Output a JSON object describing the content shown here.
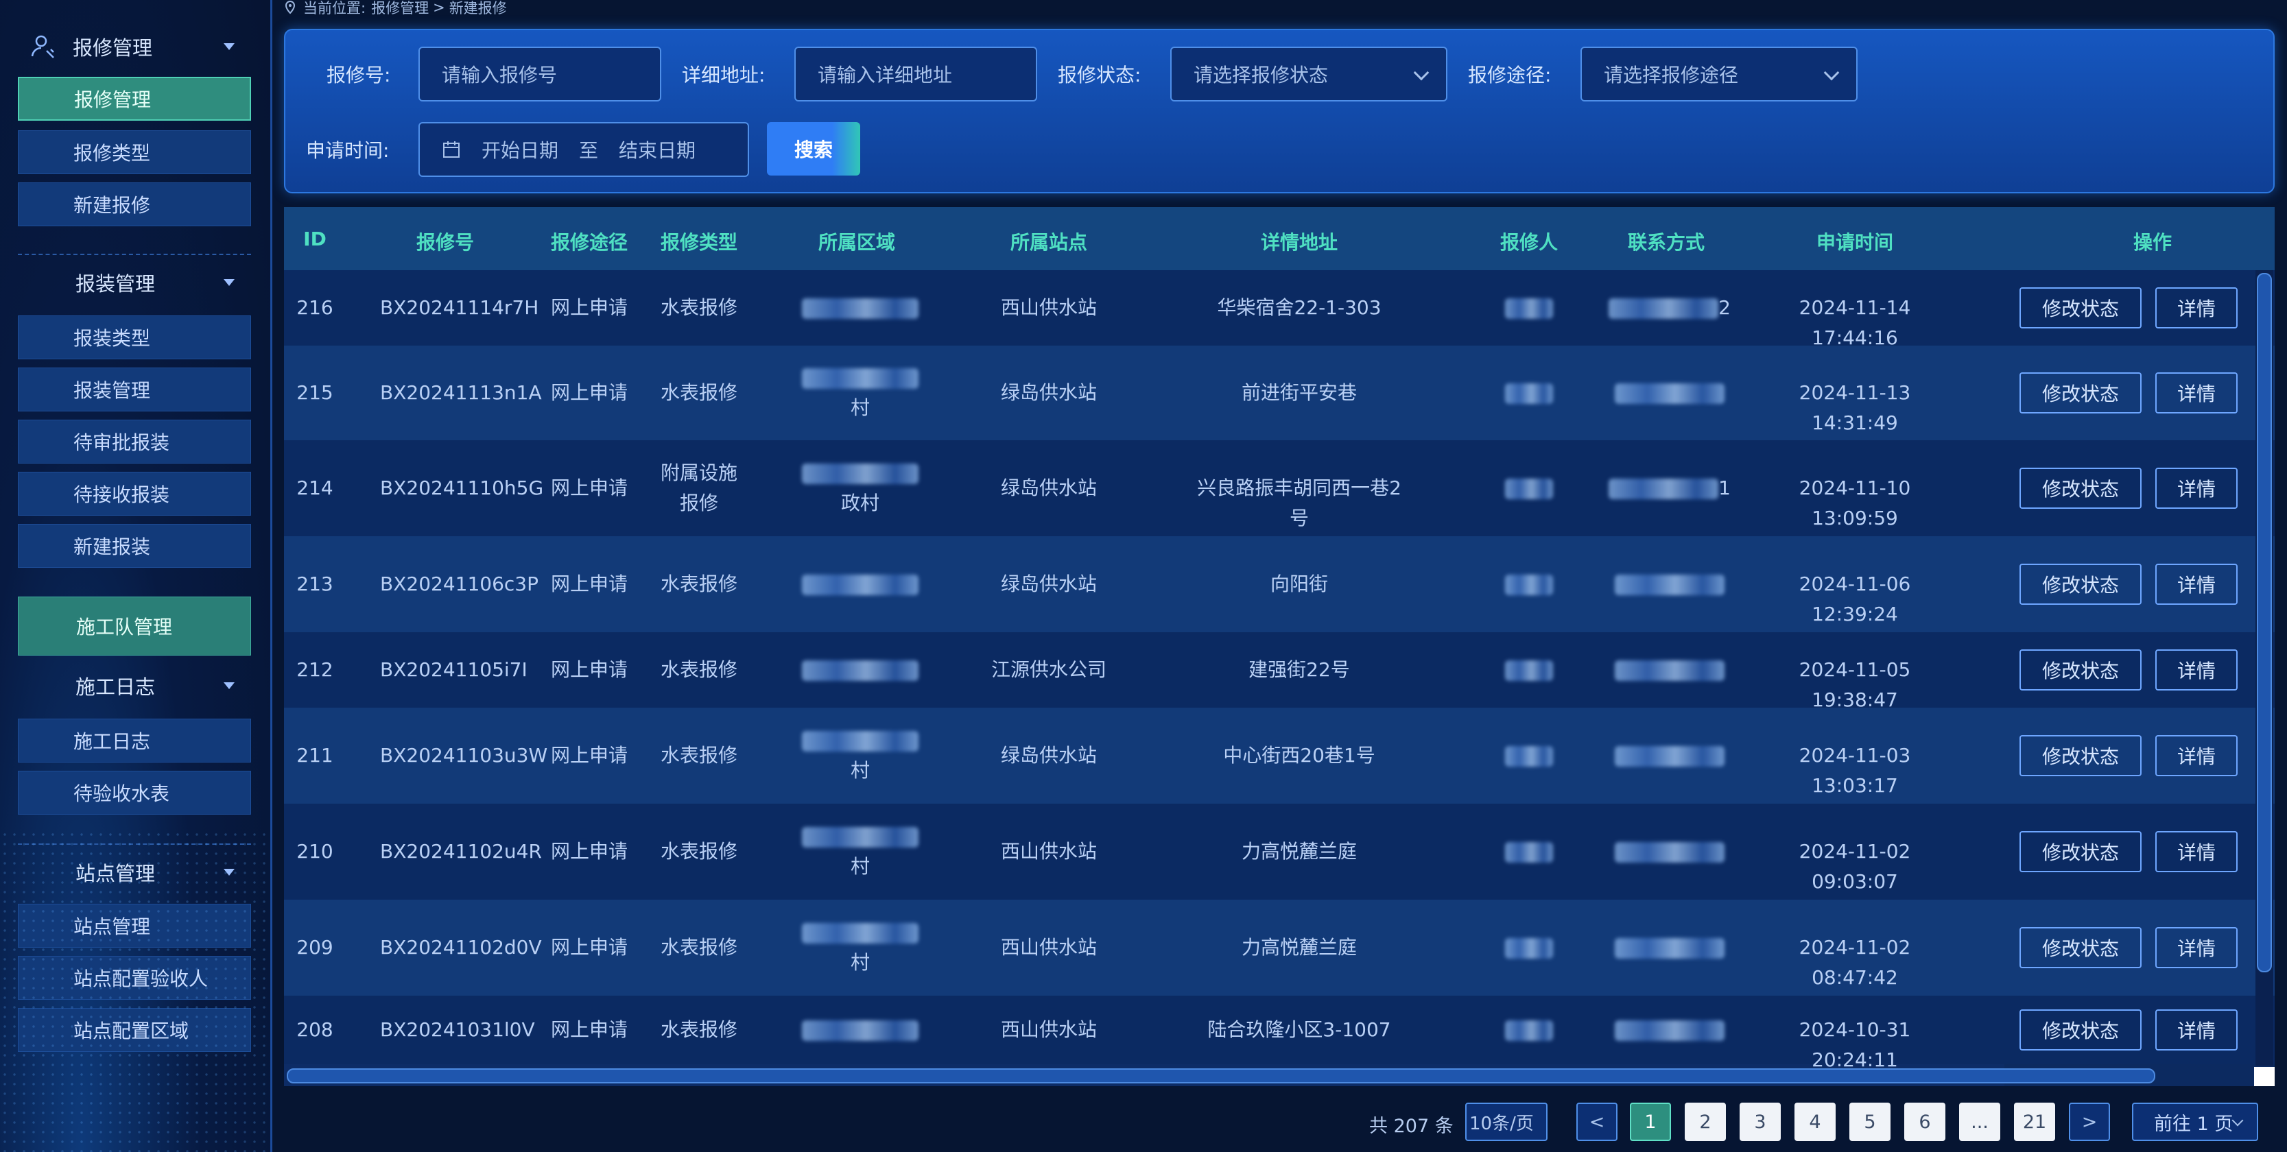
{
  "breadcrumb": {
    "prefix": "当前位置:",
    "path1": "报修管理",
    "sep": ">",
    "path2": "新建报修"
  },
  "sidebar": {
    "group1": "报修管理",
    "group1_items": [
      "报修管理",
      "报修类型",
      "新建报修"
    ],
    "group2": "报装管理",
    "group2_items": [
      "报装类型",
      "报装管理",
      "待审批报装",
      "待接收报装",
      "新建报装"
    ],
    "team": "施工队管理",
    "group3": "施工日志",
    "group3_items": [
      "施工日志",
      "待验收水表"
    ],
    "group4": "站点管理",
    "group4_items": [
      "站点管理",
      "站点配置验收人",
      "站点配置区域"
    ]
  },
  "filter": {
    "repair_no_label": "报修号:",
    "repair_no_placeholder": "请输入报修号",
    "address_label": "详细地址:",
    "address_placeholder": "请输入详细地址",
    "status_label": "报修状态:",
    "status_placeholder": "请选择报修状态",
    "channel_label": "报修途径:",
    "channel_placeholder": "请选择报修途径",
    "date_label": "申请时间:",
    "start_date": "开始日期",
    "to": "至",
    "end_date": "结束日期",
    "search": "搜索"
  },
  "table": {
    "headers": [
      "ID",
      "报修号",
      "报修途径",
      "报修类型",
      "所属区域",
      "所属站点",
      "详情地址",
      "报修人",
      "联系方式",
      "申请时间",
      "操作"
    ],
    "op_edit": "修改状态",
    "op_detail": "详情",
    "rows": [
      {
        "id": "216",
        "no": "BX20241114r7H",
        "channel": "网上申请",
        "type": "水表报修",
        "type2": "",
        "area2": "",
        "station": "西山供水站",
        "addr": "华柴宿舍22-1-303",
        "phone_tail": "2",
        "time": "2024-11-14 17:44:16"
      },
      {
        "id": "215",
        "no": "BX20241113n1A",
        "channel": "网上申请",
        "type": "水表报修",
        "type2": "",
        "area2": "村",
        "station": "绿岛供水站",
        "addr": "前进街平安巷",
        "phone_tail": "",
        "time": "2024-11-13 14:31:49"
      },
      {
        "id": "214",
        "no": "BX20241110h5G",
        "channel": "网上申请",
        "type": "附属设施",
        "type2": "报修",
        "area2": "政村",
        "station": "绿岛供水站",
        "addr": "兴良路振丰胡同西一巷2号",
        "phone_tail": "1",
        "time": "2024-11-10 13:09:59"
      },
      {
        "id": "213",
        "no": "BX20241106c3P",
        "channel": "网上申请",
        "type": "水表报修",
        "type2": "",
        "area2": "",
        "station": "绿岛供水站",
        "addr": "向阳街",
        "phone_tail": "",
        "time": "2024-11-06 12:39:24"
      },
      {
        "id": "212",
        "no": "BX20241105i7I",
        "channel": "网上申请",
        "type": "水表报修",
        "type2": "",
        "area2": "",
        "station": "江源供水公司",
        "addr": "建强街22号",
        "phone_tail": "",
        "time": "2024-11-05 19:38:47"
      },
      {
        "id": "211",
        "no": "BX20241103u3W",
        "channel": "网上申请",
        "type": "水表报修",
        "type2": "",
        "area2": "村",
        "station": "绿岛供水站",
        "addr": "中心街西20巷1号",
        "phone_tail": "",
        "time": "2024-11-03 13:03:17"
      },
      {
        "id": "210",
        "no": "BX20241102u4R",
        "channel": "网上申请",
        "type": "水表报修",
        "type2": "",
        "area2": "村",
        "station": "西山供水站",
        "addr": "力高悦麓兰庭",
        "phone_tail": "",
        "time": "2024-11-02 09:03:07"
      },
      {
        "id": "209",
        "no": "BX20241102d0V",
        "channel": "网上申请",
        "type": "水表报修",
        "type2": "",
        "area2": "村",
        "station": "西山供水站",
        "addr": "力高悦麓兰庭",
        "phone_tail": "",
        "time": "2024-11-02 08:47:42"
      },
      {
        "id": "208",
        "no": "BX20241031l0V",
        "channel": "网上申请",
        "type": "水表报修",
        "type2": "",
        "area2": "",
        "station": "西山供水站",
        "addr": "陆合玖隆小区3-1007",
        "phone_tail": "",
        "time": "2024-10-31 20:24:11"
      }
    ]
  },
  "pagination": {
    "total": "共 207 条",
    "size": "10条/页",
    "prev": "<",
    "pages": [
      "1",
      "2",
      "3",
      "4",
      "5",
      "6",
      "...",
      "21"
    ],
    "next": ">",
    "goto": "前往 1 页"
  },
  "colors": {
    "accent": "#2f7df5",
    "header_text": "#4fe0c2",
    "active_nav": "#2f8d7e"
  }
}
